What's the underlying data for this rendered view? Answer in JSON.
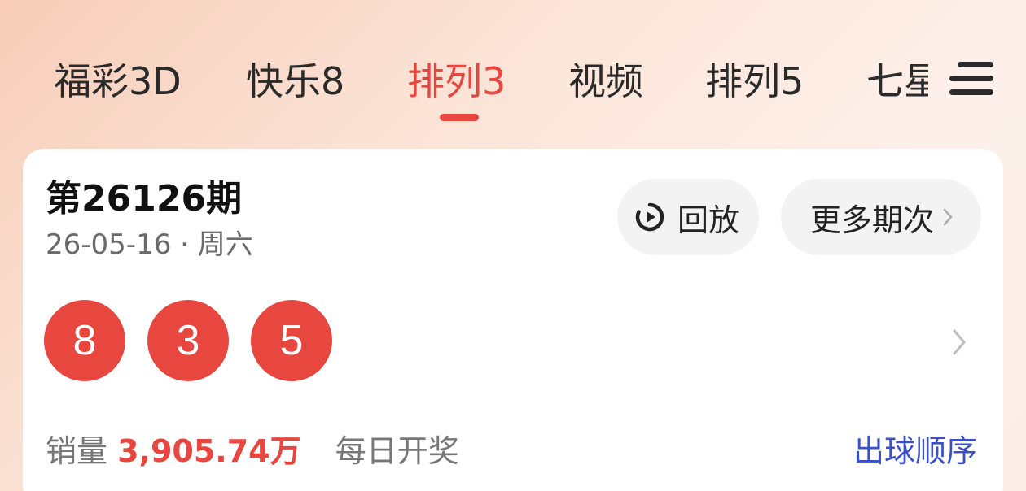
{
  "tabs": [
    {
      "label": "福彩3D",
      "active": false
    },
    {
      "label": "快乐8",
      "active": false
    },
    {
      "label": "排列3",
      "active": true
    },
    {
      "label": "视频",
      "active": false
    },
    {
      "label": "排列5",
      "active": false
    },
    {
      "label": "七星彩",
      "active": false
    }
  ],
  "menu": {
    "icon": "menu-icon"
  },
  "draw": {
    "issue": "第26126期",
    "date": "26-05-16 · 周六",
    "replay_label": "回放",
    "replay_icon": "replay-icon",
    "more_label": "更多期次",
    "numbers": [
      "8",
      "3",
      "5"
    ],
    "sales_label": "销量",
    "sales_value": "3,905.74",
    "sales_unit": "万",
    "frequency": "每日开奖",
    "order_link": "出球顺序"
  },
  "colors": {
    "accent": "#e8473f",
    "link": "#3a4fc8",
    "text": "#2a2a2a",
    "muted": "#777777"
  }
}
